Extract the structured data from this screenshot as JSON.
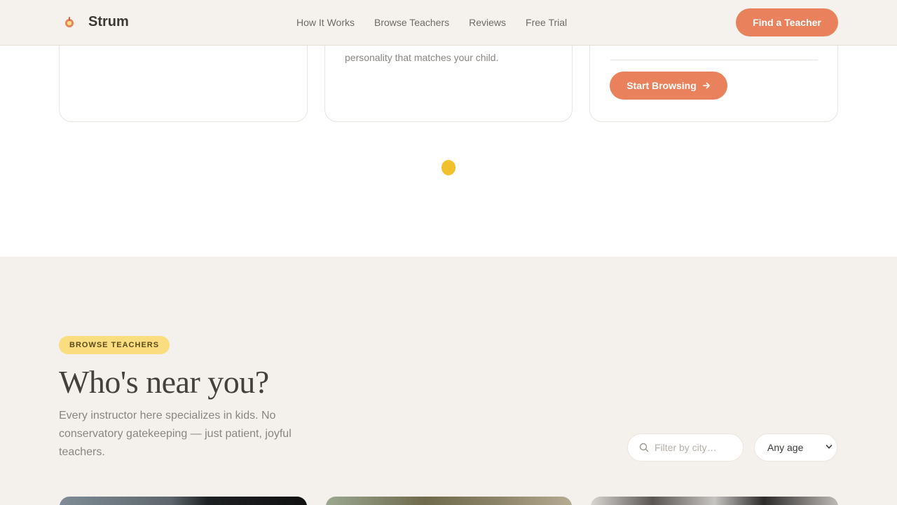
{
  "header": {
    "brand": "Strum",
    "nav": [
      "How It Works",
      "Browse Teachers",
      "Reviews",
      "Free Trial"
    ],
    "cta": "Find a Teacher"
  },
  "cards": {
    "card2_text": "personality that matches your child.",
    "browse_button": "Start Browsing"
  },
  "browse": {
    "badge": "BROWSE TEACHERS",
    "title": "Who's near you?",
    "description": "Every instructor here specializes in kids. No conservatory gatekeeping — just patient, joyful teachers.",
    "filter_placeholder": "Filter by city…",
    "age_selected": "Any age"
  },
  "colors": {
    "accent": "#e9825c",
    "badge": "#f9dd7f",
    "loader": "#f2c02c",
    "section_bg": "#f4f0eb"
  }
}
